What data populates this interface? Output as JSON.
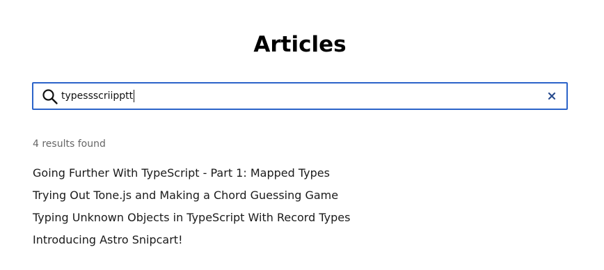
{
  "page": {
    "title": "Articles"
  },
  "search": {
    "value": "typessscriipptt",
    "icon": "search-icon",
    "clear_icon": "close-icon"
  },
  "results": {
    "count_text": "4 results found",
    "items": [
      "Going Further With TypeScript - Part 1: Mapped Types",
      "Trying Out Tone.js and Making a Chord Guessing Game",
      "Typing Unknown Objects in TypeScript With Record Types",
      "Introducing Astro Snipcart!"
    ]
  },
  "colors": {
    "accent": "#2b63c9",
    "muted_text": "#666666"
  }
}
